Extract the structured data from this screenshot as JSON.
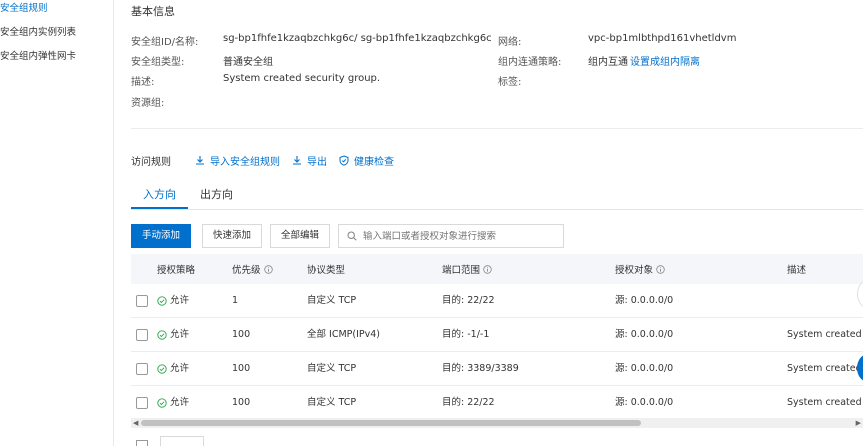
{
  "sidebar": {
    "items": [
      {
        "label": "安全组规则"
      },
      {
        "label": "安全组内实例列表"
      },
      {
        "label": "安全组内弹性网卡"
      }
    ]
  },
  "basic": {
    "title": "基本信息",
    "id_label": "安全组ID/名称:",
    "id_value": "sg-bp1fhfe1kzaqbzchkg6c/ sg-bp1fhfe1kzaqbzchkg6c",
    "type_label": "安全组类型:",
    "type_value": "普通安全组",
    "desc_label": "描述:",
    "desc_value": "System created security group.",
    "rg_label": "资源组:",
    "network_label": "网络:",
    "network_value": "vpc-bp1mlbthpd161vhetldvm",
    "policy_label": "组内连通策略:",
    "policy_value": "组内互通",
    "policy_link": "设置成组内隔离",
    "tags_label": "标签:"
  },
  "rules": {
    "title": "访问规则",
    "import_label": "导入安全组规则",
    "export_label": "导出",
    "health_label": "健康检查"
  },
  "tabs": [
    {
      "label": "入方向"
    },
    {
      "label": "出方向"
    }
  ],
  "toolbar": {
    "manual_add": "手动添加",
    "quick_add": "快速添加",
    "edit_all": "全部编辑",
    "search_placeholder": "输入端口或者授权对象进行搜索"
  },
  "table": {
    "columns": [
      "授权策略",
      "优先级",
      "协议类型",
      "端口范围",
      "授权对象",
      "描述"
    ],
    "rows": [
      {
        "policy": "允许",
        "priority": "1",
        "protocol": "自定义 TCP",
        "port": "目的: 22/22",
        "source": "源: 0.0.0.0/0",
        "desc": ""
      },
      {
        "policy": "允许",
        "priority": "100",
        "protocol": "全部 ICMP(IPv4)",
        "port": "目的: -1/-1",
        "source": "源: 0.0.0.0/0",
        "desc": "System created ru"
      },
      {
        "policy": "允许",
        "priority": "100",
        "protocol": "自定义 TCP",
        "port": "目的: 3389/3389",
        "source": "源: 0.0.0.0/0",
        "desc": "System created ru"
      },
      {
        "policy": "允许",
        "priority": "100",
        "protocol": "自定义 TCP",
        "port": "目的: 22/22",
        "source": "源: 0.0.0.0/0",
        "desc": "System created rule"
      }
    ]
  },
  "colors": {
    "accent": "#0070cc",
    "allow_green": "#22a745"
  }
}
